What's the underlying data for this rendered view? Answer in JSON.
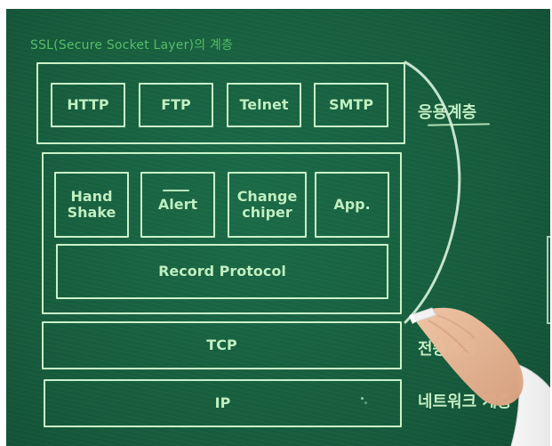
{
  "title": "SSL(Secure Socket Layer)의 계층",
  "application_layer": {
    "boxes": [
      "HTTP",
      "FTP",
      "Telnet",
      "SMTP"
    ],
    "label": "응용계층"
  },
  "ssl_layer": {
    "boxes": [
      "Hand\nShake",
      "Alert",
      "Change\nchiper",
      "App."
    ],
    "record_protocol": "Record Protocol"
  },
  "transport_layer": {
    "box": "TCP",
    "label": "전송계층"
  },
  "network_layer": {
    "box": "IP",
    "label": "네트워크 계층"
  },
  "colors": {
    "chalkboard": "#165d3d",
    "chalk": "#c9f2c9",
    "title_green": "#57c06a",
    "frame_white": "#ffffff"
  }
}
